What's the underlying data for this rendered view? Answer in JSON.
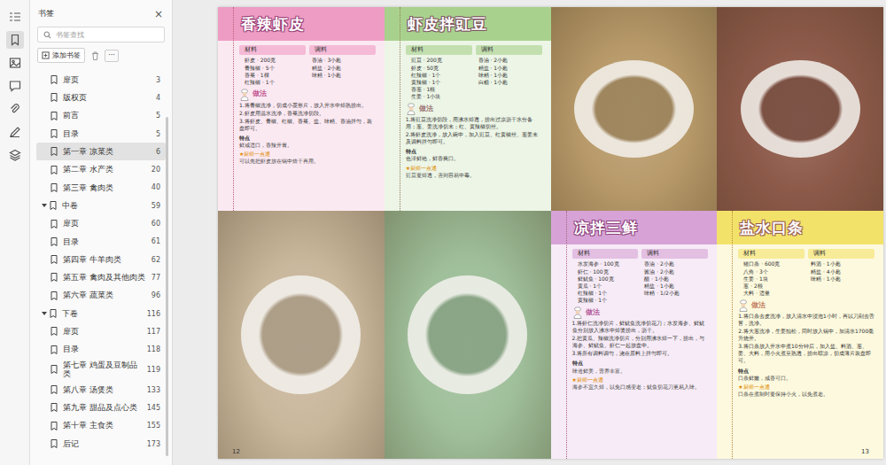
{
  "rail": [
    {
      "selected": false
    },
    {
      "selected": true
    },
    {
      "selected": false
    },
    {
      "selected": false
    },
    {
      "selected": false
    },
    {
      "selected": false
    },
    {
      "selected": false
    }
  ],
  "panel": {
    "title": "书签",
    "close": "×",
    "search": {
      "placeholder": "书签查找"
    },
    "add_button": "添加书签",
    "more_button": "···",
    "scrollbar": {
      "level": 0.88
    }
  },
  "bookmarks": [
    {
      "label": "扉页",
      "page": "3",
      "kind": "item",
      "expanded": false,
      "selected": false
    },
    {
      "label": "版权页",
      "page": "4",
      "kind": "item",
      "expanded": false,
      "selected": false
    },
    {
      "label": "前言",
      "page": "5",
      "kind": "item",
      "expanded": false,
      "selected": false
    },
    {
      "label": "目录",
      "page": "5",
      "kind": "item",
      "expanded": false,
      "selected": false
    },
    {
      "label": "第一章 凉菜类",
      "page": "6",
      "kind": "item",
      "expanded": false,
      "selected": true
    },
    {
      "label": "第二章 水产类",
      "page": "20",
      "kind": "item",
      "expanded": false,
      "selected": false
    },
    {
      "label": "第三章 禽肉类",
      "page": "40",
      "kind": "item",
      "expanded": false,
      "selected": false
    },
    {
      "label": "中卷",
      "page": "59",
      "kind": "group",
      "expanded": true,
      "selected": false
    },
    {
      "label": "扉页",
      "page": "60",
      "kind": "item",
      "expanded": false,
      "selected": false
    },
    {
      "label": "目录",
      "page": "61",
      "kind": "item",
      "expanded": false,
      "selected": false
    },
    {
      "label": "第四章 牛羊肉类",
      "page": "62",
      "kind": "item",
      "expanded": false,
      "selected": false
    },
    {
      "label": "第五章 禽肉及其他肉类",
      "page": "77",
      "kind": "item",
      "expanded": false,
      "selected": false
    },
    {
      "label": "第六章 蔬菜类",
      "page": "96",
      "kind": "item",
      "expanded": false,
      "selected": false
    },
    {
      "label": "下卷",
      "page": "116",
      "kind": "group",
      "expanded": true,
      "selected": false
    },
    {
      "label": "扉页",
      "page": "117",
      "kind": "item",
      "expanded": false,
      "selected": false
    },
    {
      "label": "目录",
      "page": "118",
      "kind": "item",
      "expanded": false,
      "selected": false
    },
    {
      "label": "第七章 鸡蛋及豆制品类",
      "page": "119",
      "kind": "item",
      "expanded": false,
      "selected": false
    },
    {
      "label": "第八章 汤煲类",
      "page": "133",
      "kind": "item",
      "expanded": false,
      "selected": false
    },
    {
      "label": "第九章 甜品及点心类",
      "page": "145",
      "kind": "item",
      "expanded": false,
      "selected": false
    },
    {
      "label": "第十章 主食类",
      "page": "155",
      "kind": "item",
      "expanded": false,
      "selected": false
    },
    {
      "label": "后记",
      "page": "173",
      "kind": "item",
      "expanded": false,
      "selected": false
    }
  ],
  "pages": [
    {
      "number": "12",
      "cells": [
        {
          "kind": "recipe",
          "title": "香辣虾皮",
          "color": "#ef9cc4",
          "labels": {
            "ingredients": "材料",
            "seasonings": "调料",
            "method": "做法",
            "feature": "特点",
            "tip": "★厨师一点通"
          },
          "ingredients": [
            "虾皮 · 200克",
            "青辣椒 · 5个",
            "香菜 · 1棵",
            "红辣椒 · 1个"
          ],
          "seasonings": [
            "香油 · 3小匙",
            "精盐 · 2小匙",
            "味精 · 1小匙"
          ],
          "steps": [
            "1.将青椒洗净，切成小菱形片，放入开水中焯熟捞出。",
            "2.虾皮用温水洗净，香菜洗净切段。",
            "3.将虾皮、青椒、红椒、香菜、盐、味精、香油拌匀，装盘即可。"
          ],
          "feature": "鲜咸适口，香辣开胃。",
          "tip": "可以先把虾皮放在锅中焙干再用。"
        },
        {
          "kind": "recipe",
          "title": "虾皮拌豇豆",
          "color": "#a9d18e",
          "labels": {
            "ingredients": "材料",
            "seasonings": "调料",
            "method": "做法",
            "feature": "特点",
            "tip": "★厨师一点通"
          },
          "ingredients": [
            "豇豆 · 200克",
            "虾皮 · 50克",
            "红辣椒 · 1个",
            "黄辣椒 · 1个",
            "香葱 · 1根",
            "生姜 · 1小块"
          ],
          "seasonings": [
            "香油 · 2小匙",
            "精盐 · 1小匙",
            "味精 · 1小匙",
            "白糖 · 1小匙"
          ],
          "steps": [
            "1.将豇豆洗净切段，用沸水焯透，捞出过凉沥干水分备用；葱、姜洗净切末；红、黄辣椒切丝。",
            "2.将虾皮洗净，放入碗中，加入豇豆、红黄椒丝、葱姜末及调料拌匀即可。"
          ],
          "feature": "色泽鲜艳，鲜香爽口。",
          "tip": "豇豆要焯透，否则容易中毒。"
        },
        {
          "kind": "photo",
          "color": "#c9b79c"
        },
        {
          "kind": "photo",
          "color": "#9fbf9a"
        }
      ]
    },
    {
      "number": "13",
      "cells": [
        {
          "kind": "photo",
          "color": "#b89a6a"
        },
        {
          "kind": "photo",
          "color": "#8d5a4a"
        },
        {
          "kind": "recipe",
          "title": "凉拌三鲜",
          "color": "#d7a3d6",
          "labels": {
            "ingredients": "材料",
            "seasonings": "调料",
            "method": "做法",
            "feature": "特点",
            "tip": "★厨师一点通"
          },
          "ingredients": [
            "水发海参 · 100克",
            "虾仁 · 100克",
            "鲜鱿鱼 · 100克",
            "黄瓜 · 1个",
            "红辣椒 · 1个",
            "黄辣椒 · 1个"
          ],
          "seasonings": [
            "香油 · 2小匙",
            "酱油 · 2小匙",
            "醋 · 1小匙",
            "精盐 · 1小匙",
            "味精 · 1/2小匙"
          ],
          "steps": [
            "1.将虾仁洗净切片，鲜鱿鱼洗净切花刀；水发海参、鲜鱿鱼分别放入沸水中焯烫捞出，沥干。",
            "2.把黄瓜、辣椒洗净切片，分别用沸水焯一下，捞出，与海参、鲜鱿鱼、虾仁一起放盘中。",
            "3.将所有调料调匀，浇在原料上拌匀即可。"
          ],
          "feature": "味道鲜美，营养丰富。",
          "tip": "海参不宜久焯，以免口感变老；鱿鱼切花刀更易入味。"
        },
        {
          "kind": "recipe",
          "title": "盐水口条",
          "color": "#f3e26a",
          "labels": {
            "ingredients": "材料",
            "seasonings": "调料",
            "method": "做法",
            "feature": "特点",
            "tip": "★厨师一点通"
          },
          "ingredients": [
            "猪口条 · 600克",
            "八角 · 3个",
            "生姜 · 1块",
            "葱 · 2根",
            "大料 · 适量"
          ],
          "seasonings": [
            "料酒 · 1小匙",
            "精盐 · 4小匙",
            "味精 · 1小匙"
          ],
          "steps": [
            "1.将口条去皮洗净，放入清水中浸泡1小时，再以刀刮去舌苔，洗净。",
            "2.将大葱洗净，生姜拍松，同时放入锅中，加清水1700毫升烧开。",
            "3.将口条放入开水中煮10分钟后，加入盐、料酒、葱、姜、大料，用小火煮至熟透，捞出晾凉，切成薄片装盘即可。"
          ],
          "feature": "口条鲜嫩，咸香可口。",
          "tip": "口条在煮制时要保持小火，以免煮老。"
        }
      ]
    }
  ]
}
